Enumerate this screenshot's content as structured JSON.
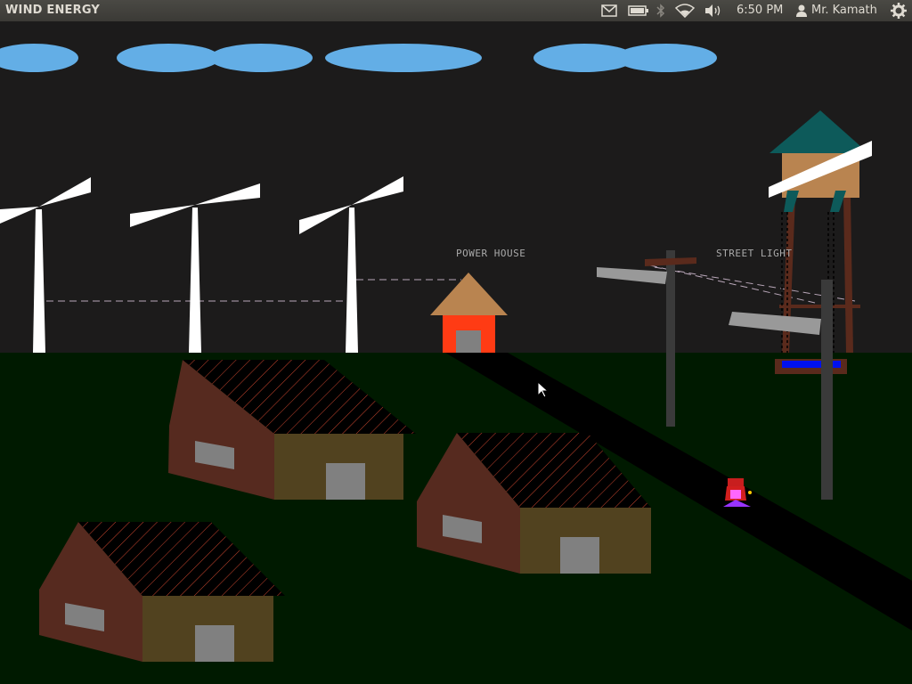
{
  "window": {
    "title": "WIND ENERGY"
  },
  "panel": {
    "clock": "6:50 PM",
    "user": "Mr. Kamath",
    "indicators": [
      "mail-icon",
      "battery-icon",
      "bluetooth-icon",
      "wifi-icon",
      "volume-icon",
      "user-icon",
      "gear-icon"
    ]
  },
  "scene": {
    "labels": {
      "power_house": "POWER HOUSE",
      "street_light": "STREET LIGHT"
    },
    "colors": {
      "sky": "#1c1b1b",
      "ground": "#001a00",
      "cloud": "#63aee6",
      "house_wall": "#562a1f",
      "house_front": "#51421f",
      "power_house": "#ff3b14",
      "road": "#000000"
    }
  }
}
